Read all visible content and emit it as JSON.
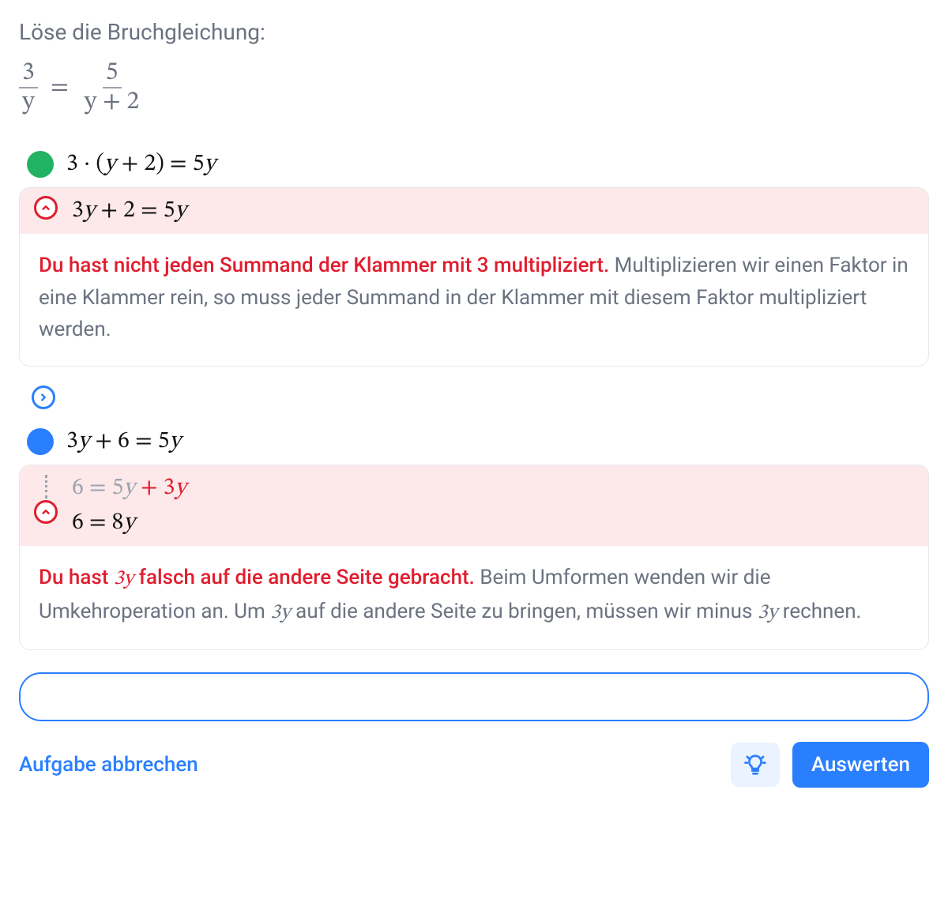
{
  "prompt": "Löse die Bruchgleichung:",
  "problem": {
    "left_num": "3",
    "left_den": "y",
    "eq": "=",
    "right_num": "5",
    "right_den": "y + 2"
  },
  "steps": {
    "s1": {
      "math": "3 · (y + 2) = 5y"
    },
    "err1": {
      "head_math": "3y + 2 = 5y",
      "lead": "Du hast nicht jeden Summand der Klammer mit 3 multipliziert.",
      "rest": " Multiplizieren wir einen Faktor in eine Klammer rein, so muss jeder Summand in der Klammer mit diesem Faktor multipliziert werden."
    },
    "s2": {
      "math": "3y + 6 = 5y"
    },
    "err2": {
      "line1_pre": "6 = 5y",
      "line1_red": " + 3y",
      "line2": "6 = 8y",
      "lead_pre": "Du hast ",
      "lead_mid": "3y",
      "lead_post": " falsch auf die andere Seite gebracht.",
      "rest_pre": " Beim Umformen wenden wir die Umkehroperation an. Um ",
      "rest_mid": "3y",
      "rest_post": " auf die andere Seite zu bringen, müssen wir minus ",
      "rest_mid2": "3y",
      "rest_end": " rechnen."
    }
  },
  "footer": {
    "cancel": "Aufgabe abbrechen",
    "evaluate": "Auswerten"
  }
}
